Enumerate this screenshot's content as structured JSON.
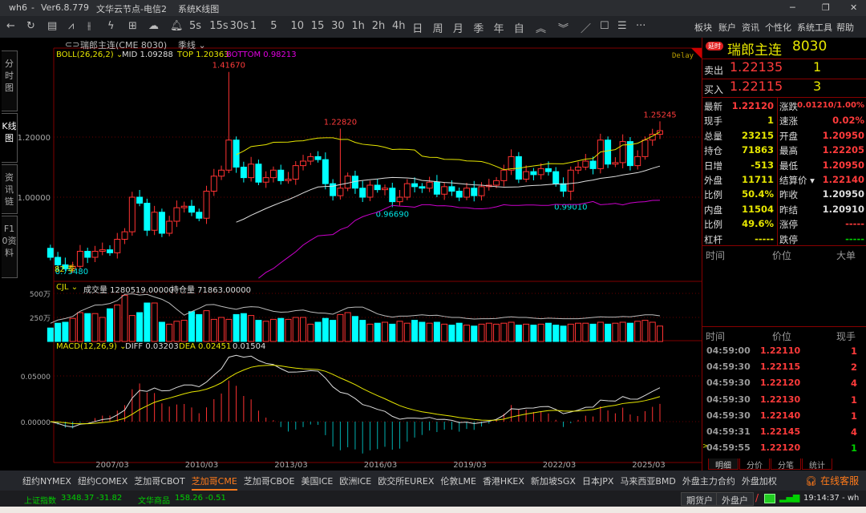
{
  "titlebar": {
    "app": "wh6",
    "sep": "-",
    "version": "Ver6.8.779",
    "server": "文华云节点-电信2",
    "view": "系统K线图"
  },
  "window_controls": {
    "minimize": "─",
    "restore": "❐",
    "close": "✕"
  },
  "toolbar": {
    "icons": [
      "back-icon",
      "refresh-icon",
      "list-icon",
      "line-chart-icon",
      "candle-icon",
      "flash-icon",
      "panel-icon",
      "cloud-icon",
      "bell-icon"
    ],
    "periods": [
      "5s",
      "15s",
      "30s",
      "1",
      "5",
      "10",
      "15",
      "30",
      "1h",
      "2h",
      "4h",
      "日",
      "周",
      "月",
      "季",
      "年",
      "自"
    ],
    "tools": [
      "︽",
      "︾",
      "／",
      "☐",
      "☰",
      "···"
    ],
    "menus": [
      "板块",
      "账户",
      "资讯",
      "个性化",
      "系统工具",
      "帮助"
    ]
  },
  "symbol_bar": {
    "name": "瑞郎主连(CME 8030)",
    "period": "季线"
  },
  "side_tabs": [
    "分时图",
    "K线图",
    "资讯链",
    "F10资料"
  ],
  "boll": {
    "label": "BOLL(26,26,2)",
    "mid": "MID 1.09288",
    "top": "TOP 1.20363",
    "bottom": "BOTTOM 0.98213",
    "delay": "Delay"
  },
  "volume_header": {
    "label": "CJL",
    "vol": "成交量 1280519.00000",
    "oi": "持仓量 71863.00000"
  },
  "macd_header": {
    "label": "MACD(12,26,9)",
    "diff": "DIFF 0.03203",
    "dea": "DEA 0.02451",
    "macd": "0.01504"
  },
  "colors": {
    "up": "#ff3232",
    "down": "#00ffff",
    "boll_mid": "#dddddd",
    "boll_top": "#e6e600",
    "boll_bottom": "#cc00cc",
    "grid": "#800000"
  },
  "chart_data": {
    "type": "candlestick",
    "title": "瑞郎主连(CME 8030) 季线",
    "x_tick_labels": [
      "2007/03",
      "2010/03",
      "2013/03",
      "2016/03",
      "2019/03",
      "2022/03",
      "2025/03"
    ],
    "price_ticks": [
      "1.20000",
      "1.00000"
    ],
    "volume_ticks": [
      "500万",
      "250万"
    ],
    "macd_ticks": [
      "0.05000",
      "0.00000"
    ],
    "first_open": 0.83,
    "closes": [
      0.8,
      0.775,
      0.762,
      0.77,
      0.82,
      0.8,
      0.82,
      0.825,
      0.815,
      0.86,
      0.885,
      1.0,
      0.98,
      0.89,
      0.95,
      0.88,
      0.92,
      0.965,
      0.97,
      0.95,
      0.93,
      1.02,
      1.07,
      1.09,
      1.19,
      1.1,
      1.065,
      1.11,
      1.05,
      1.065,
      1.09,
      1.055,
      1.06,
      1.105,
      1.12,
      1.135,
      1.125,
      1.045,
      1.005,
      1.03,
      1.07,
      1.03,
      1.0,
      1.04,
      1.025,
      1.03,
      0.985,
      1.0,
      1.045,
      1.035,
      1.03,
      1.05,
      1.01,
      1.035,
      1.02,
      1.0,
      1.03,
      1.005,
      1.035,
      1.04,
      1.055,
      1.09,
      1.135,
      1.06,
      1.085,
      1.075,
      1.095,
      1.085,
      1.045,
      1.02,
      1.09,
      1.1,
      1.12,
      1.095,
      1.19,
      1.11,
      1.115,
      1.185,
      1.105,
      1.135,
      1.19,
      1.2095,
      1.2212
    ],
    "volumes_wan": [
      140,
      190,
      200,
      240,
      300,
      290,
      290,
      250,
      340,
      380,
      480,
      270,
      300,
      400,
      400,
      200,
      180,
      210,
      220,
      310,
      280,
      320,
      230,
      250,
      230,
      280,
      290,
      270,
      220,
      210,
      230,
      240,
      230,
      250,
      250,
      180,
      200,
      240,
      220,
      280,
      300,
      260,
      220,
      180,
      190,
      200,
      180,
      210,
      190,
      220,
      200,
      190,
      200,
      180,
      170,
      190,
      170,
      160,
      180,
      190,
      180,
      190,
      200,
      170,
      180,
      170,
      180,
      190,
      170,
      160,
      180,
      190,
      190,
      180,
      200,
      180,
      190,
      200,
      190,
      210,
      220,
      200,
      160
    ],
    "annotations": [
      {
        "index": 24,
        "type": "high",
        "value": 1.4167,
        "label": "1.41670"
      },
      {
        "index": 39,
        "type": "high",
        "value": 1.2282,
        "label": "1.22820"
      },
      {
        "index": 46,
        "type": "low",
        "value": 0.9669,
        "label": "0.96690"
      },
      {
        "index": 70,
        "type": "low",
        "value": 0.9901,
        "label": "0.99010"
      },
      {
        "index": 82,
        "type": "high",
        "value": 1.25245,
        "label": "1.25245"
      },
      {
        "index": 2,
        "type": "low",
        "value": 0.7548,
        "label": "0.75480"
      }
    ],
    "count_label": "82 季"
  },
  "quote": {
    "badge": "延时",
    "name": "瑞郎主连",
    "code": "8030",
    "ask_label": "卖出",
    "ask": "1.22135",
    "ask_vol": "1",
    "bid_label": "买入",
    "bid": "1.22115",
    "bid_vol": "3",
    "stats_left": [
      [
        "最新",
        "1.22120",
        "r"
      ],
      [
        "现手",
        "1",
        "y"
      ],
      [
        "总量",
        "23215",
        "y"
      ],
      [
        "持仓",
        "71863",
        "y"
      ],
      [
        "日增",
        "-513",
        "y"
      ],
      [
        "外盘",
        "11711",
        "y"
      ],
      [
        "比例",
        "50.4%",
        "y"
      ],
      [
        "内盘",
        "11504",
        "y"
      ],
      [
        "比例",
        "49.6%",
        "y"
      ],
      [
        "杠杆",
        "-----",
        "y"
      ]
    ],
    "stats_right": [
      [
        "涨跌",
        "0.01210/1.00%",
        "r"
      ],
      [
        "速涨",
        "0.02%",
        "r"
      ],
      [
        "开盘",
        "1.20950",
        "r"
      ],
      [
        "最高",
        "1.22205",
        "r"
      ],
      [
        "最低",
        "1.20950",
        "r"
      ],
      [
        "结算价 ▾",
        "1.22140",
        "r"
      ],
      [
        "昨收",
        "1.20950",
        "w"
      ],
      [
        "昨结",
        "1.20910",
        "w"
      ],
      [
        "涨停",
        "-----",
        "r"
      ],
      [
        "跌停",
        "-----",
        "g"
      ]
    ],
    "big_header": [
      "时间",
      "价位",
      "大单"
    ],
    "ticks_header": [
      "时间",
      "价位",
      "现手"
    ],
    "ticks": [
      [
        "04:59:00",
        "1.22110",
        "1",
        "r"
      ],
      [
        "04:59:30",
        "1.22115",
        "2",
        "r"
      ],
      [
        "04:59:30",
        "1.22120",
        "4",
        "r"
      ],
      [
        "04:59:30",
        "1.22130",
        "1",
        "r"
      ],
      [
        "04:59:30",
        "1.22140",
        "1",
        "r"
      ],
      [
        "04:59:31",
        "1.22145",
        "4",
        "r"
      ],
      [
        "04:59:55",
        "1.22120",
        "1",
        "g"
      ]
    ],
    "tabs": [
      "明细",
      "分价",
      "分笔",
      "统计"
    ]
  },
  "exchanges": [
    "纽约NYMEX",
    "纽约COMEX",
    "芝加哥CBOT",
    "芝加哥CME",
    "芝加哥CBOE",
    "美国ICE",
    "欧洲ICE",
    "欧交所EUREX",
    "伦敦LME",
    "香港HKEX",
    "新加坡SGX",
    "日本JPX",
    "马来西亚BMD",
    "外盘主力合约",
    "外盘加权"
  ],
  "active_exchange": "芝加哥CME",
  "support": "在线客服",
  "status": {
    "idx1_name": "上证指数",
    "idx1_val": "3348.37",
    "idx1_chg": "-31.82",
    "idx2_name": "文华商品",
    "idx2_val": "158.26",
    "idx2_chg": "-0.51",
    "btn1": "期货户",
    "btn2": "外盘户",
    "time": "19:14:37 - wh"
  }
}
